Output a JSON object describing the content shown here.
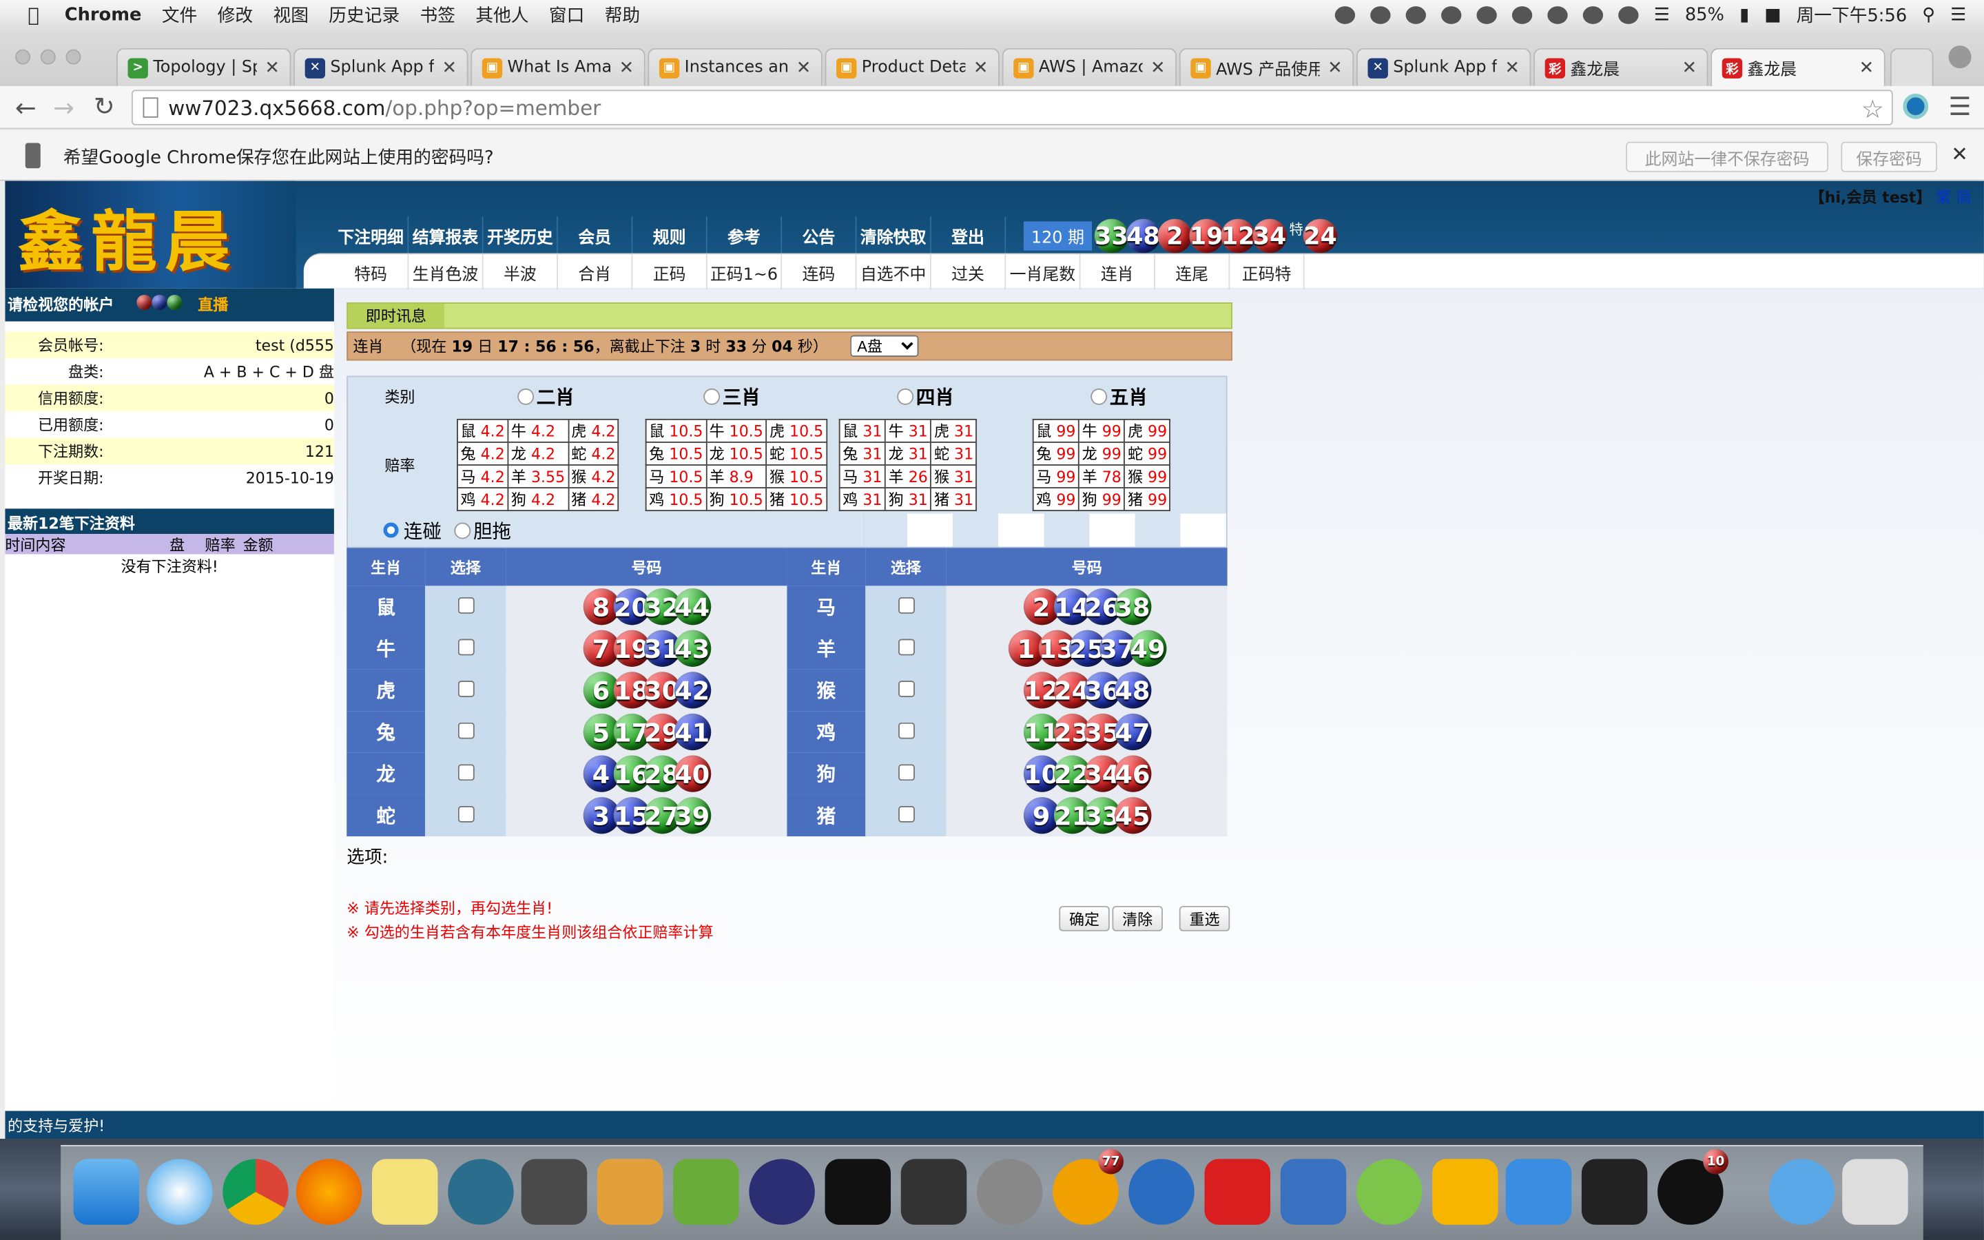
{
  "menubar": {
    "app": "Chrome",
    "items": [
      "文件",
      "修改",
      "视图",
      "历史记录",
      "书签",
      "其他人",
      "窗口",
      "帮助"
    ],
    "battery": "85%",
    "clock": "周一下午5:56"
  },
  "tabs": [
    {
      "title": "Topology | Splu",
      "color": "#3a9a3a",
      "glyph": ">"
    },
    {
      "title": "Splunk App for",
      "color": "#1d3c78",
      "glyph": "✕"
    },
    {
      "title": "What Is Amazo",
      "color": "#f0a020",
      "glyph": "▣"
    },
    {
      "title": "Instances and",
      "color": "#f0a020",
      "glyph": "▣"
    },
    {
      "title": "Product Details",
      "color": "#f0a020",
      "glyph": "▣"
    },
    {
      "title": "AWS | Amazon",
      "color": "#f0a020",
      "glyph": "▣"
    },
    {
      "title": "AWS 产品使用",
      "color": "#f0a020",
      "glyph": "▣"
    },
    {
      "title": "Splunk App for",
      "color": "#1d3c78",
      "glyph": "✕"
    },
    {
      "title": "鑫龙晨",
      "color": "#d81e1e",
      "glyph": "彩"
    },
    {
      "title": "鑫龙晨",
      "color": "#d81e1e",
      "glyph": "彩"
    }
  ],
  "url": {
    "host": "ww7023.qx5668.com",
    "path": "/op.php?op=member"
  },
  "infobar": {
    "text": "希望Google Chrome保存您在此网站上使用的密码吗?",
    "never": "此网站一律不保存密码",
    "save": "保存密码"
  },
  "site": {
    "logo": "鑫龍晨",
    "greeting": "【hi,会员 test】",
    "lang1": "繁",
    "lang2": "简",
    "menu_top": [
      "下注明细",
      "结算报表",
      "开奖历史",
      "会员",
      "规则",
      "参考",
      "公告",
      "清除快取",
      "登出"
    ],
    "menu_sub": [
      "特码",
      "生肖色波",
      "半波",
      "合肖",
      "正码",
      "正码1~6",
      "连码",
      "自选不中",
      "过关",
      "一肖尾数",
      "连肖",
      "连尾",
      "正码特"
    ],
    "period": "120 期",
    "draw": [
      {
        "n": "33",
        "c": "green"
      },
      {
        "n": "48",
        "c": "blue"
      },
      {
        "n": "2",
        "c": "red"
      },
      {
        "n": "19",
        "c": "red"
      },
      {
        "n": "12",
        "c": "red"
      },
      {
        "n": "34",
        "c": "red"
      },
      {
        "n": "24",
        "c": "red"
      }
    ],
    "special_label": "特"
  },
  "sidebar": {
    "title": "请检视您的帐户",
    "live": "直播",
    "rows": [
      {
        "k": "会员帐号:",
        "v": "test (d555"
      },
      {
        "k": "盘类:",
        "v": "A + B + C + D 盘"
      },
      {
        "k": "信用额度:",
        "v": "0"
      },
      {
        "k": "已用额度:",
        "v": "0"
      },
      {
        "k": "下注期数:",
        "v": "121"
      },
      {
        "k": "开奖日期:",
        "v": "2015-10-19"
      }
    ],
    "recent_title": "最新12笔下注资料",
    "cols": [
      "时间内容",
      "盘",
      "赔率",
      "金额"
    ],
    "empty": "没有下注资料!",
    "footer": "的支持与爱护!"
  },
  "main": {
    "news_label": "即时讯息",
    "status": {
      "game": "连肖",
      "text1": "（现在",
      "day": "19",
      "text2": "日",
      "time": "17 : 56 : 56",
      "text3": "，离截止下注",
      "h": "3",
      "text4": "时",
      "m": "33",
      "text5": "分",
      "s": "04",
      "text6": "秒）"
    },
    "plate": "A盘",
    "cat_label": "类别",
    "odds_label": "赔率",
    "cats": [
      {
        "name": "二肖",
        "odds": [
          [
            "鼠",
            "4.2",
            "牛",
            "4.2",
            "虎",
            "4.2"
          ],
          [
            "兔",
            "4.2",
            "龙",
            "4.2",
            "蛇",
            "4.2"
          ],
          [
            "马",
            "4.2",
            "羊",
            "3.55",
            "猴",
            "4.2"
          ],
          [
            "鸡",
            "4.2",
            "狗",
            "4.2",
            "猪",
            "4.2"
          ]
        ]
      },
      {
        "name": "三肖",
        "odds": [
          [
            "鼠",
            "10.5",
            "牛",
            "10.5",
            "虎",
            "10.5"
          ],
          [
            "兔",
            "10.5",
            "龙",
            "10.5",
            "蛇",
            "10.5"
          ],
          [
            "马",
            "10.5",
            "羊",
            "8.9",
            "猴",
            "10.5"
          ],
          [
            "鸡",
            "10.5",
            "狗",
            "10.5",
            "猪",
            "10.5"
          ]
        ]
      },
      {
        "name": "四肖",
        "odds": [
          [
            "鼠",
            "31",
            "牛",
            "31",
            "虎",
            "31"
          ],
          [
            "兔",
            "31",
            "龙",
            "31",
            "蛇",
            "31"
          ],
          [
            "马",
            "31",
            "羊",
            "26",
            "猴",
            "31"
          ],
          [
            "鸡",
            "31",
            "狗",
            "31",
            "猪",
            "31"
          ]
        ]
      },
      {
        "name": "五肖",
        "odds": [
          [
            "鼠",
            "99",
            "牛",
            "99",
            "虎",
            "99"
          ],
          [
            "兔",
            "99",
            "龙",
            "99",
            "蛇",
            "99"
          ],
          [
            "马",
            "99",
            "羊",
            "78",
            "猴",
            "99"
          ],
          [
            "鸡",
            "99",
            "狗",
            "99",
            "猪",
            "99"
          ]
        ]
      }
    ],
    "mode1": "连碰",
    "mode2": "胆拖",
    "headers": [
      "生肖",
      "选择",
      "号码",
      "生肖",
      "选择",
      "号码"
    ],
    "left": [
      {
        "z": "鼠",
        "balls": [
          [
            "8",
            "red"
          ],
          [
            "20",
            "blue"
          ],
          [
            "32",
            "green"
          ],
          [
            "44",
            "green"
          ]
        ]
      },
      {
        "z": "牛",
        "balls": [
          [
            "7",
            "red"
          ],
          [
            "19",
            "red"
          ],
          [
            "31",
            "blue"
          ],
          [
            "43",
            "green"
          ]
        ]
      },
      {
        "z": "虎",
        "balls": [
          [
            "6",
            "green"
          ],
          [
            "18",
            "red"
          ],
          [
            "30",
            "red"
          ],
          [
            "42",
            "blue"
          ]
        ]
      },
      {
        "z": "兔",
        "balls": [
          [
            "5",
            "green"
          ],
          [
            "17",
            "green"
          ],
          [
            "29",
            "red"
          ],
          [
            "41",
            "blue"
          ]
        ]
      },
      {
        "z": "龙",
        "balls": [
          [
            "4",
            "blue"
          ],
          [
            "16",
            "green"
          ],
          [
            "28",
            "green"
          ],
          [
            "40",
            "red"
          ]
        ]
      },
      {
        "z": "蛇",
        "balls": [
          [
            "3",
            "blue"
          ],
          [
            "15",
            "blue"
          ],
          [
            "27",
            "green"
          ],
          [
            "39",
            "green"
          ]
        ]
      }
    ],
    "right": [
      {
        "z": "马",
        "balls": [
          [
            "2",
            "red"
          ],
          [
            "14",
            "blue"
          ],
          [
            "26",
            "blue"
          ],
          [
            "38",
            "green"
          ]
        ]
      },
      {
        "z": "羊",
        "balls": [
          [
            "1",
            "red"
          ],
          [
            "13",
            "red"
          ],
          [
            "25",
            "blue"
          ],
          [
            "37",
            "blue"
          ],
          [
            "49",
            "green"
          ]
        ]
      },
      {
        "z": "猴",
        "balls": [
          [
            "12",
            "red"
          ],
          [
            "24",
            "red"
          ],
          [
            "36",
            "blue"
          ],
          [
            "48",
            "blue"
          ]
        ]
      },
      {
        "z": "鸡",
        "balls": [
          [
            "11",
            "green"
          ],
          [
            "23",
            "red"
          ],
          [
            "35",
            "red"
          ],
          [
            "47",
            "blue"
          ]
        ]
      },
      {
        "z": "狗",
        "balls": [
          [
            "10",
            "blue"
          ],
          [
            "22",
            "green"
          ],
          [
            "34",
            "red"
          ],
          [
            "46",
            "red"
          ]
        ]
      },
      {
        "z": "猪",
        "balls": [
          [
            "9",
            "blue"
          ],
          [
            "21",
            "green"
          ],
          [
            "33",
            "green"
          ],
          [
            "45",
            "red"
          ]
        ]
      }
    ],
    "options_label": "选项:",
    "note1": "※ 请先选择类别，再勾选生肖!",
    "note2": "※ 勾选的生肖若含有本年度生肖则该组合依正赔率计算",
    "btn_ok": "确定",
    "btn_clear": "清除",
    "btn_reset": "重选"
  },
  "dock": {
    "badge_outlook": "77",
    "badge_qq": "10"
  }
}
